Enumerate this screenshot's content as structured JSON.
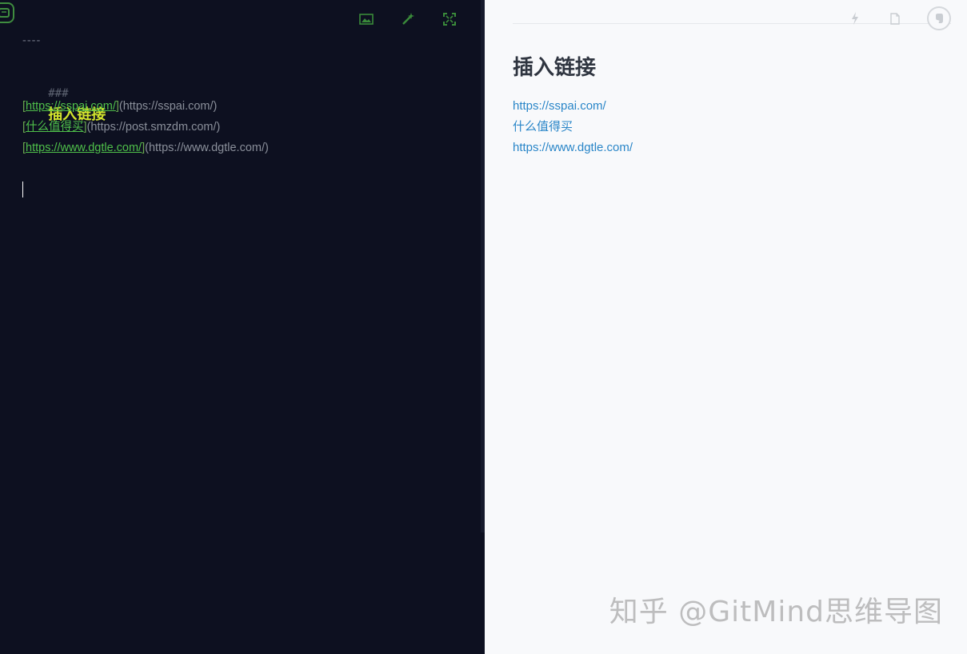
{
  "editor": {
    "hr": "----",
    "heading_marker": "###",
    "heading_text": "插入链接",
    "links": [
      {
        "text": "https://sspai.com/",
        "url": "(https://sspai.com/)"
      },
      {
        "text": "什么值得买",
        "url": "(https://post.smzdm.com/)"
      },
      {
        "text": "https://www.dgtle.com/",
        "url": "(https://www.dgtle.com/)"
      }
    ],
    "bracket_open": "[",
    "bracket_close": "]",
    "toolbar": {
      "image_icon": "image-icon",
      "magic_icon": "magic-wand-icon",
      "fullscreen_icon": "fullscreen-icon"
    },
    "colors": {
      "background": "#0d1020",
      "heading": "#d4e62c",
      "link": "#4fc04a"
    }
  },
  "preview": {
    "title": "插入链接",
    "links": [
      "https://sspai.com/",
      "什么值得买",
      "https://www.dgtle.com/"
    ],
    "toolbar": {
      "lightning_icon": "lightning-icon",
      "document_icon": "document-icon",
      "evernote_icon": "evernote-icon"
    },
    "colors": {
      "background": "#f8f9fb",
      "link": "#2a86c8"
    }
  },
  "watermark": "知乎 @GitMind思维导图"
}
